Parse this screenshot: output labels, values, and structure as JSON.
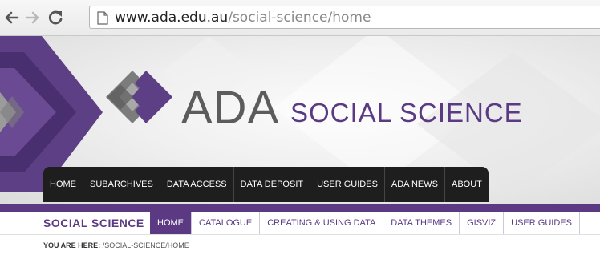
{
  "browser": {
    "back_icon": "back-arrow-icon",
    "forward_icon": "forward-arrow-icon",
    "reload_icon": "reload-icon",
    "page_icon": "page-icon",
    "url_host": "www.ada.edu.au",
    "url_path": "/social-science/home"
  },
  "header": {
    "logo_text": "ADA",
    "logo_sub": "SOCIAL SCIENCE",
    "brand_color": "#5b3a83"
  },
  "main_nav": {
    "items": [
      {
        "label": "HOME"
      },
      {
        "label": "SUBARCHIVES"
      },
      {
        "label": "DATA ACCESS"
      },
      {
        "label": "DATA DEPOSIT"
      },
      {
        "label": "USER GUIDES"
      },
      {
        "label": "ADA NEWS"
      },
      {
        "label": "ABOUT"
      }
    ]
  },
  "sub_nav": {
    "title": "SOCIAL SCIENCE",
    "items": [
      {
        "label": "HOME",
        "active": true
      },
      {
        "label": "CATALOGUE"
      },
      {
        "label": "CREATING & USING DATA"
      },
      {
        "label": "DATA THEMES"
      },
      {
        "label": "GISVIZ"
      },
      {
        "label": "USER GUIDES"
      }
    ]
  },
  "breadcrumb": {
    "label": "YOU ARE HERE:",
    "path": "/SOCIAL-SCIENCE/HOME"
  }
}
